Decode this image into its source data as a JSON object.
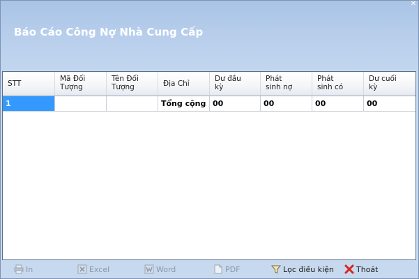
{
  "window": {
    "title": "Báo Cáo Công Nợ Nhà Cung Cấp"
  },
  "grid": {
    "columns": [
      {
        "line1": "STT",
        "line2": ""
      },
      {
        "line1": "Mã Đối",
        "line2": "Tượng"
      },
      {
        "line1": "Tên Đối",
        "line2": "Tượng"
      },
      {
        "line1": "Địa Chỉ",
        "line2": ""
      },
      {
        "line1": "Dư đầu",
        "line2": "kỳ"
      },
      {
        "line1": "Phát",
        "line2": "sinh nợ"
      },
      {
        "line1": "Phát",
        "line2": "sinh có"
      },
      {
        "line1": "Dư cuối",
        "line2": "kỳ"
      }
    ],
    "rows": [
      [
        "1",
        "",
        "",
        "Tổng cộng",
        "00",
        "00",
        "00",
        "00"
      ]
    ]
  },
  "toolbar": {
    "print_label": "In",
    "excel_label": "Excel",
    "word_label": "Word",
    "pdf_label": "PDF",
    "filter_label": "Lọc điều kiện",
    "exit_label": "Thoát"
  },
  "icons": {
    "close": "close-icon",
    "print": "printer-icon",
    "excel": "excel-icon",
    "word": "word-icon",
    "pdf": "pdf-icon",
    "filter": "funnel-icon",
    "exit": "red-x-icon"
  },
  "colors": {
    "selection": "#3399ff",
    "exit_icon": "#d7261e",
    "disabled_text": "#8a97a8"
  }
}
